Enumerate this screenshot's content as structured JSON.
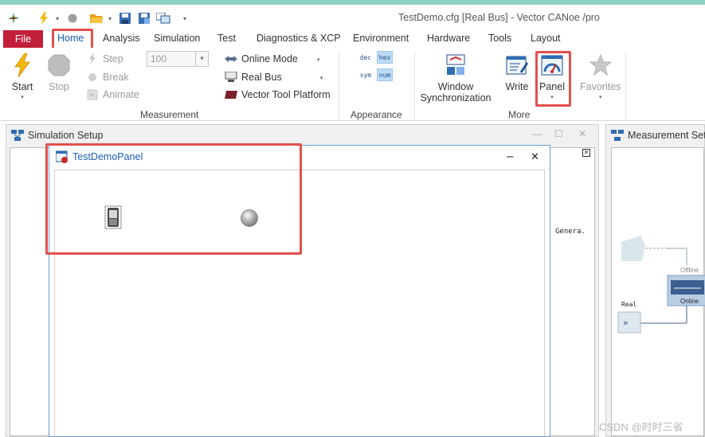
{
  "app": {
    "window_title": "TestDemo.cfg [Real Bus] - Vector CANoe /pro"
  },
  "menu": {
    "file": "File",
    "tabs": [
      "Home",
      "Analysis",
      "Simulation",
      "Test",
      "Diagnostics & XCP",
      "Environment",
      "Hardware",
      "Tools",
      "Layout"
    ],
    "active_tab": "Home"
  },
  "ribbon": {
    "measurement": {
      "label": "Measurement",
      "start": "Start",
      "stop": "Stop",
      "step": "Step",
      "break": "Break",
      "animate": "Animate",
      "speed_value": "100",
      "online_mode": "Online Mode",
      "real_bus": "Real Bus",
      "vector_tool_platform": "Vector Tool Platform"
    },
    "appearance": {
      "label": "Appearance",
      "dec": "dec",
      "hex": "hex",
      "sym": "sym",
      "num": "num"
    },
    "more": {
      "label": "More",
      "window_sync_line1": "Window",
      "window_sync_line2": "Synchronization",
      "write": "Write",
      "panel": "Panel",
      "favorites": "Favorites"
    }
  },
  "panes": {
    "simulation_setup": "Simulation Setup",
    "measurement_setup": "Measurement Set",
    "sim_peek_text": "Genera.",
    "meas_offline": "Offline",
    "meas_online": "Online",
    "meas_real": "Real"
  },
  "panel_window": {
    "title": "TestDemoPanel",
    "minimize": "–",
    "close": "✕"
  },
  "watermark": "CSDN @时时三省",
  "colors": {
    "file_tab": "#c21f3a",
    "highlight": "#e2504f",
    "accent_blue": "#1a5fb4",
    "title_strip": "#8fd1c4"
  }
}
